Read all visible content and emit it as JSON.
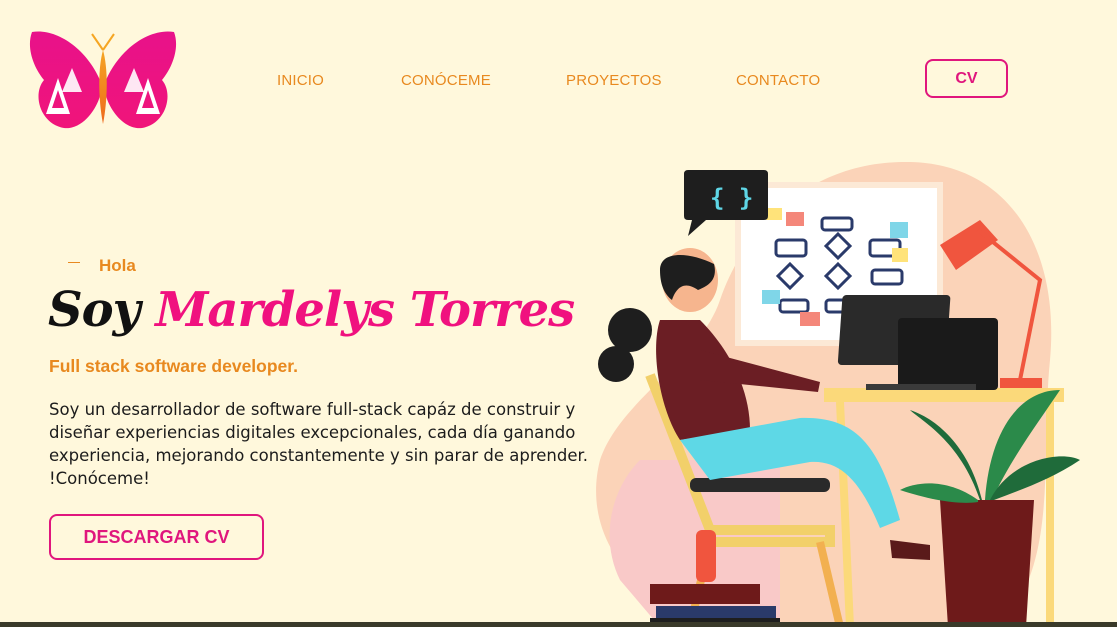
{
  "logo": {
    "icon": "butterfly-logo-icon",
    "gradient_top": "#e8128a",
    "gradient_bottom": "#f5a623"
  },
  "nav": {
    "items": [
      {
        "label": "INICIO"
      },
      {
        "label": "CONÓCEME"
      },
      {
        "label": "PROYECTOS"
      },
      {
        "label": "CONTACTO"
      }
    ],
    "cv_label": "CV"
  },
  "hero": {
    "greeting": "Hola",
    "title_prefix": "Soy",
    "title_name": "Mardelys Torres",
    "subtitle": "Full stack software developer.",
    "description": "Soy un desarrollador de software full-stack capáz de construir y diseñar experiencias digitales excepcionales, cada día ganando experiencia, mejorando constantemente y sin parar de aprender. !Conóceme!",
    "download_label": "DESCARGAR CV",
    "illustration_code_icon": "{ }"
  },
  "colors": {
    "accent_pink": "#f0117f",
    "accent_orange": "#e8891f",
    "background": "#fff8dc"
  }
}
